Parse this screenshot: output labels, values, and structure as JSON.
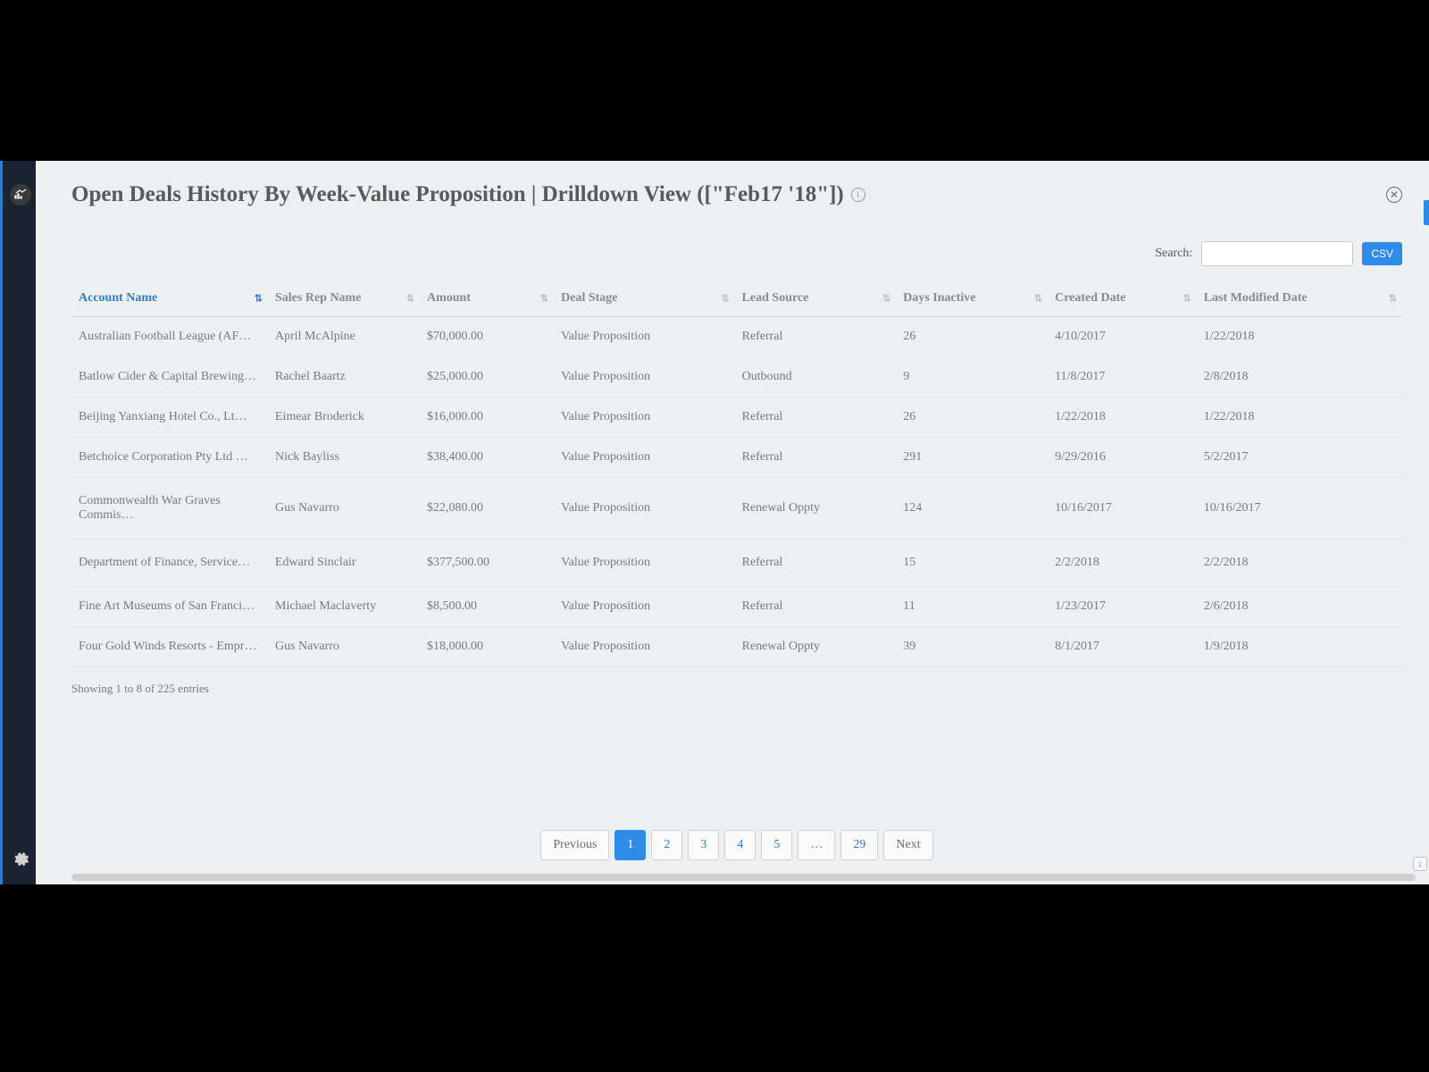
{
  "header": {
    "title": "Open Deals History By Week-Value Proposition | Drilldown View ([\"Feb17 '18\"])"
  },
  "toolbar": {
    "search_label": "Search:",
    "search_value": "",
    "csv_label": "CSV"
  },
  "columns": [
    {
      "label": "Account Name",
      "sorted": true
    },
    {
      "label": "Sales Rep Name",
      "sorted": false
    },
    {
      "label": "Amount",
      "sorted": false
    },
    {
      "label": "Deal Stage",
      "sorted": false
    },
    {
      "label": "Lead Source",
      "sorted": false
    },
    {
      "label": "Days Inactive",
      "sorted": false
    },
    {
      "label": "Created Date",
      "sorted": false
    },
    {
      "label": "Last Modified Date",
      "sorted": false
    }
  ],
  "rows": [
    {
      "account": "Australian Football League (AF…",
      "salesrep": "April McAlpine",
      "amount": "$70,000.00",
      "stage": "Value Proposition",
      "source": "Referral",
      "inactive": "26",
      "created": "4/10/2017",
      "modified": "1/22/2018"
    },
    {
      "account": "Batlow Cider & Capital Brewing…",
      "salesrep": "Rachel Baartz",
      "amount": "$25,000.00",
      "stage": "Value Proposition",
      "source": "Outbound",
      "inactive": "9",
      "created": "11/8/2017",
      "modified": "2/8/2018"
    },
    {
      "account": "Beijing Yanxiang Hotel Co., Lt…",
      "salesrep": "Eimear Broderick",
      "amount": "$16,000.00",
      "stage": "Value Proposition",
      "source": "Referral",
      "inactive": "26",
      "created": "1/22/2018",
      "modified": "1/22/2018"
    },
    {
      "account": "Betchoice Corporation Pty Ltd …",
      "salesrep": "Nick Bayliss",
      "amount": "$38,400.00",
      "stage": "Value Proposition",
      "source": "Referral",
      "inactive": "291",
      "created": "9/29/2016",
      "modified": "5/2/2017"
    },
    {
      "account": "Commonwealth War Graves Commis…",
      "salesrep": "Gus Navarro",
      "amount": "$22,080.00",
      "stage": "Value Proposition",
      "source": "Renewal Oppty",
      "inactive": "124",
      "created": "10/16/2017",
      "modified": "10/16/2017"
    },
    {
      "account": "Department of Finance, Service…",
      "salesrep": "Edward Sinclair",
      "amount": "$377,500.00",
      "stage": "Value Proposition",
      "source": "Referral",
      "inactive": "15",
      "created": "2/2/2018",
      "modified": "2/2/2018"
    },
    {
      "account": "Fine Art Museums of San Franci…",
      "salesrep": "Michael Maclaverty",
      "amount": "$8,500.00",
      "stage": "Value Proposition",
      "source": "Referral",
      "inactive": "11",
      "created": "1/23/2017",
      "modified": "2/6/2018"
    },
    {
      "account": "Four Gold Winds Resorts - Empr…",
      "salesrep": "Gus Navarro",
      "amount": "$18,000.00",
      "stage": "Value Proposition",
      "source": "Renewal Oppty",
      "inactive": "39",
      "created": "8/1/2017",
      "modified": "1/9/2018"
    }
  ],
  "footer": {
    "info": "Showing 1 to 8 of 225 entries"
  },
  "pagination": {
    "prev": "Previous",
    "next": "Next",
    "pages": [
      "1",
      "2",
      "3",
      "4",
      "5",
      "…",
      "29"
    ],
    "active": "1"
  }
}
